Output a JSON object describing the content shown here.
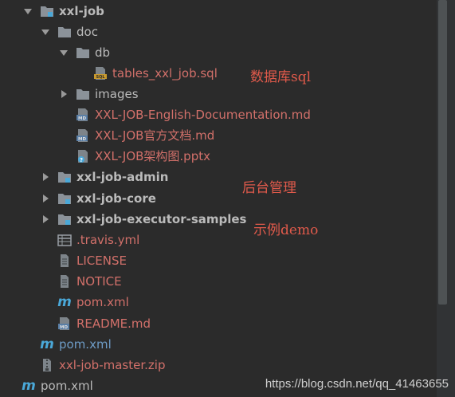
{
  "tree": {
    "root": "xxl-job",
    "doc": "doc",
    "db": "db",
    "tables_sql": "tables_xxl_job.sql",
    "images": "images",
    "english_doc": "XXL-JOB-English-Documentation.md",
    "cn_doc": "XXL-JOB官方文档.md",
    "arch_ppt": "XXL-JOB架构图.pptx",
    "admin": "xxl-job-admin",
    "core": "xxl-job-core",
    "executor": "xxl-job-executor-samples",
    "travis": ".travis.yml",
    "license": "LICENSE",
    "notice": "NOTICE",
    "pom_inner": "pom.xml",
    "readme": "README.md",
    "pom_root": "pom.xml",
    "zip": "xxl-job-master.zip",
    "pom_outer": "pom.xml"
  },
  "annotations": {
    "db_note": "数据库sql",
    "admin_note": "后台管理",
    "sample_note": "示例demo"
  },
  "watermark": "https://blog.csdn.net/qq_41463655",
  "colors": {
    "background": "#2b2b2b",
    "annotation": "#e05a4b",
    "modified_file": "#d2706a",
    "folder": "#8b9299",
    "maven_icon": "#4aa8d8"
  },
  "icons": [
    "chevron-down-icon",
    "chevron-right-icon",
    "folder-icon",
    "module-folder-icon",
    "sql-file-icon",
    "markdown-file-icon",
    "unknown-file-icon",
    "yaml-file-icon",
    "text-file-icon",
    "maven-icon",
    "archive-file-icon"
  ]
}
